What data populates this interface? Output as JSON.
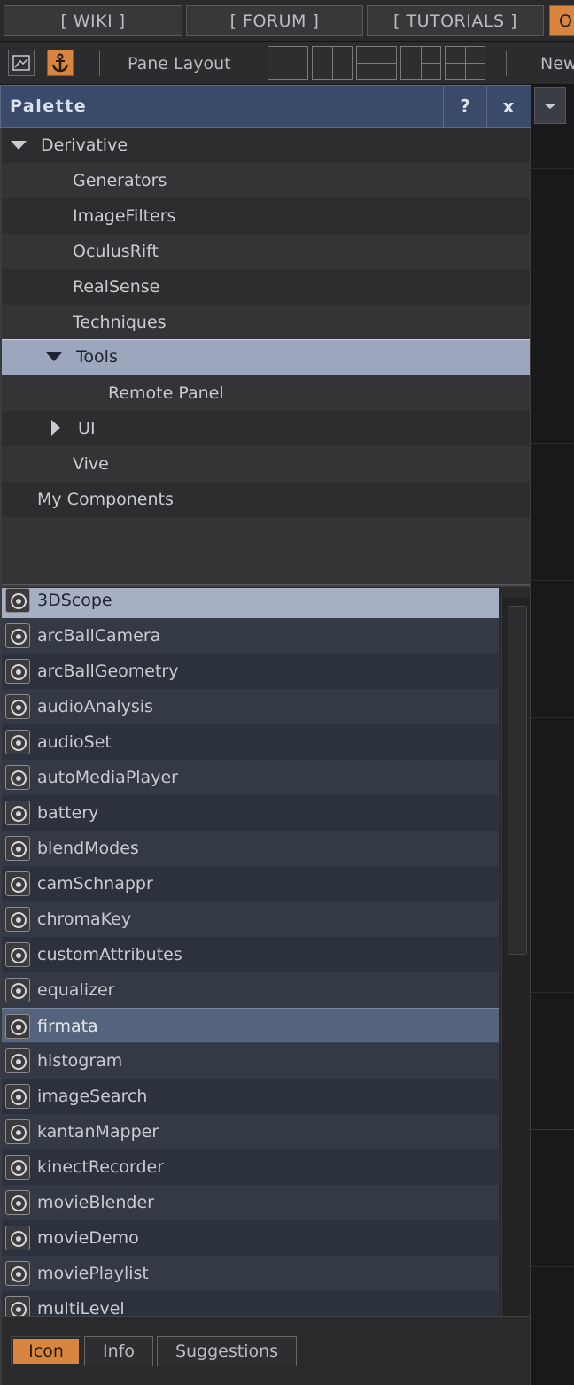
{
  "nav": {
    "wiki": "[ WIKI ]",
    "forum": "[ FORUM ]",
    "tutorials": "[ TUTORIALS ]",
    "more": "O"
  },
  "toolbar": {
    "pane_layout_label": "Pane Layout",
    "new_label": "New"
  },
  "palette": {
    "title": "Palette",
    "help_label": "?",
    "close_label": "x"
  },
  "tree": {
    "derivative": "Derivative",
    "generators": "Generators",
    "imagefilters": "ImageFilters",
    "oculusrift": "OculusRift",
    "realsense": "RealSense",
    "techniques": "Techniques",
    "tools": "Tools",
    "remote_panel": "Remote Panel",
    "ui": "UI",
    "vive": "Vive",
    "my_components": "My Components"
  },
  "components": [
    "3DScope",
    "arcBallCamera",
    "arcBallGeometry",
    "audioAnalysis",
    "audioSet",
    "autoMediaPlayer",
    "battery",
    "blendModes",
    "camSchnappr",
    "chromaKey",
    "customAttributes",
    "equalizer",
    "firmata",
    "histogram",
    "imageSearch",
    "kantanMapper",
    "kinectRecorder",
    "movieBlender",
    "movieDemo",
    "moviePlaylist",
    "multiLevel"
  ],
  "selected_component": "firmata",
  "tabs": {
    "icon": "Icon",
    "info": "Info",
    "suggestions": "Suggestions"
  },
  "colors": {
    "accent_orange": "#d8863f",
    "header_blue": "#3a4a6a",
    "selection": "#9ca7bd"
  }
}
